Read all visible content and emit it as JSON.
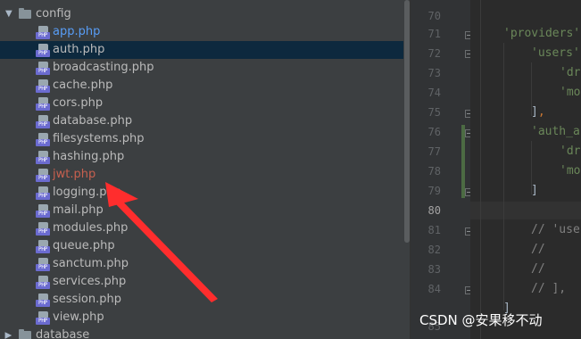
{
  "project_tree": {
    "partial_top": "",
    "config_folder": {
      "label": "config",
      "expanded": true
    },
    "files": [
      {
        "label": "app.php",
        "badge": "PHP",
        "state": "active"
      },
      {
        "label": "auth.php",
        "badge": "PHP",
        "state": "selected"
      },
      {
        "label": "broadcasting.php",
        "badge": "PHP",
        "state": ""
      },
      {
        "label": "cache.php",
        "badge": "PHP",
        "state": ""
      },
      {
        "label": "cors.php",
        "badge": "PHP",
        "state": ""
      },
      {
        "label": "database.php",
        "badge": "PHP",
        "state": ""
      },
      {
        "label": "filesystems.php",
        "badge": "PHP",
        "state": ""
      },
      {
        "label": "hashing.php",
        "badge": "PHP",
        "state": ""
      },
      {
        "label": "jwt.php",
        "badge": "PHP",
        "state": "modified"
      },
      {
        "label": "logging.php",
        "badge": "PHP",
        "state": ""
      },
      {
        "label": "mail.php",
        "badge": "PHP",
        "state": ""
      },
      {
        "label": "modules.php",
        "badge": "PHP",
        "state": ""
      },
      {
        "label": "queue.php",
        "badge": "PHP",
        "state": ""
      },
      {
        "label": "sanctum.php",
        "badge": "PHP",
        "state": ""
      },
      {
        "label": "services.php",
        "badge": "PHP",
        "state": ""
      },
      {
        "label": "session.php",
        "badge": "PHP",
        "state": ""
      },
      {
        "label": "view.php",
        "badge": "PHP",
        "state": ""
      }
    ],
    "database_folder": {
      "label": "database",
      "expanded": false
    }
  },
  "editor": {
    "current_line": "80",
    "line_numbers": [
      "70",
      "71",
      "72",
      "73",
      "74",
      "75",
      "76",
      "77",
      "78",
      "79",
      "80",
      "81",
      "82",
      "83",
      "84",
      "85"
    ],
    "code": {
      "l69": "'",
      "l71_a": "'providers'",
      "l71_b": " =",
      "l72_a": "'users'",
      "l72_b": " =",
      "l73": "'dr",
      "l74": "'mo",
      "l75_a": "]",
      "l75_b": ",",
      "l76": "'auth_a",
      "l77": "'dr",
      "l78": "'mo",
      "l79": "]",
      "l81": "// 'use",
      "l82": "//",
      "l83": "//",
      "l84": "// ],",
      "l85": "]"
    }
  },
  "annotation": {
    "type": "red-arrow",
    "points_to": "jwt.php"
  },
  "watermark": "CSDN @安果移不动",
  "colors": {
    "tree_bg": "#3c3f41",
    "selection": "#0d293e",
    "modified_file": "#c7604f",
    "active_file": "#589df6",
    "php_badge": "#6b6bd0",
    "string": "#6a8759",
    "keyword": "#cc7832",
    "arrow": "#ff2d2d"
  }
}
